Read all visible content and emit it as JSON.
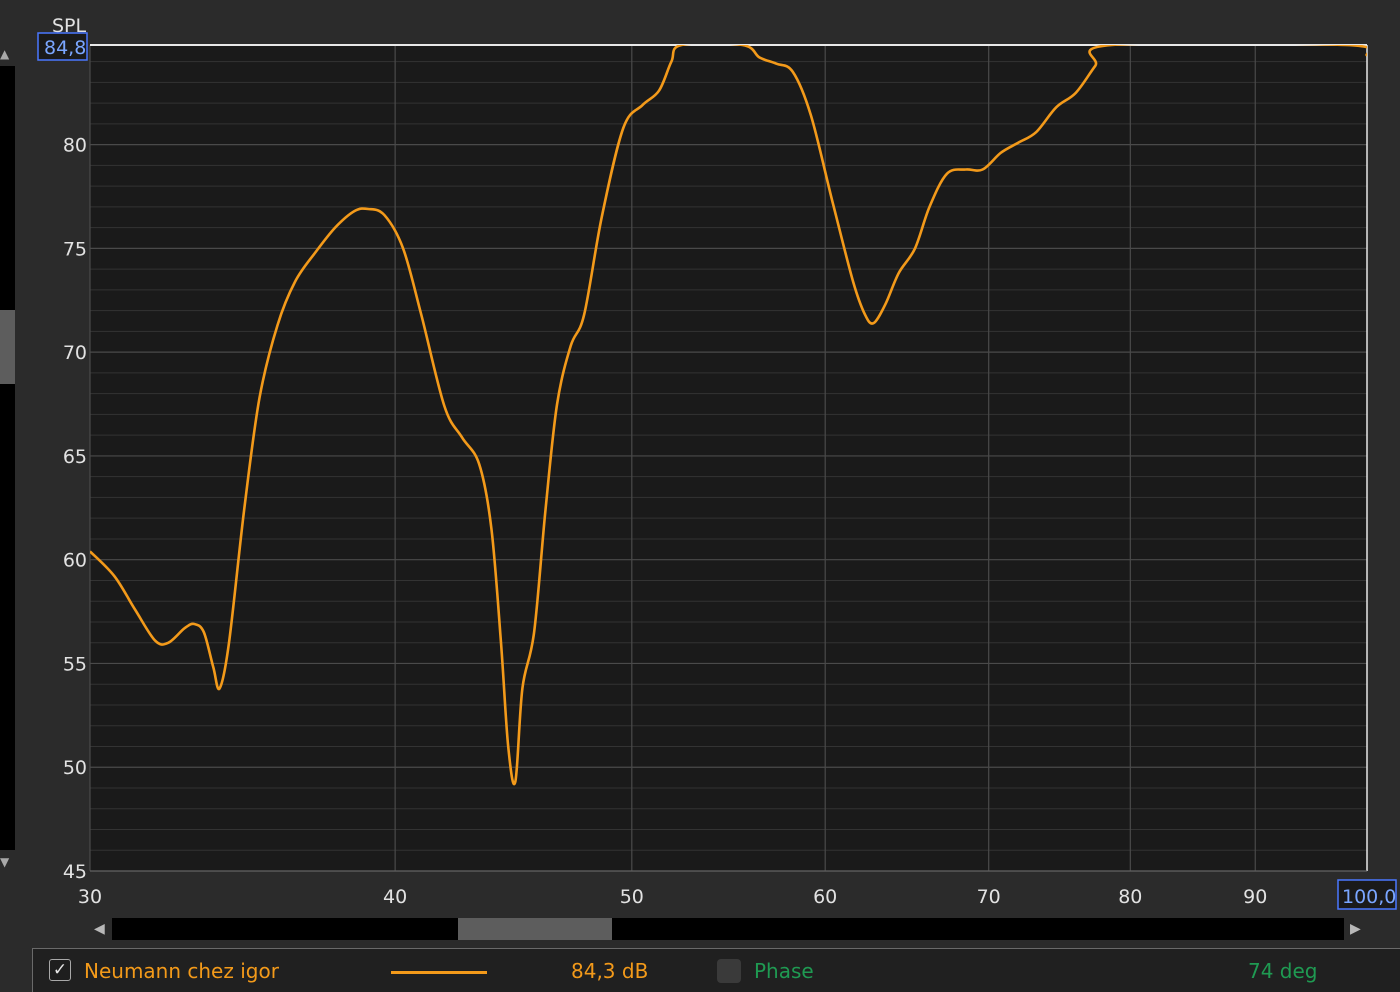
{
  "chart_data": {
    "type": "line",
    "ylabel": "SPL",
    "ylim": [
      45,
      84.8
    ],
    "xlim": [
      30,
      100
    ],
    "x_scale": "log",
    "grid": true,
    "ymax_readout": "84,8",
    "xmax_readout": "100,0",
    "y_ticks": [
      {
        "value": 45,
        "label": "45"
      },
      {
        "value": 50,
        "label": "50"
      },
      {
        "value": 55,
        "label": "55"
      },
      {
        "value": 60,
        "label": "60"
      },
      {
        "value": 65,
        "label": "65"
      },
      {
        "value": 70,
        "label": "70"
      },
      {
        "value": 75,
        "label": "75"
      },
      {
        "value": 80,
        "label": "80"
      }
    ],
    "x_ticks": [
      {
        "value": 30,
        "label": "30"
      },
      {
        "value": 40,
        "label": "40"
      },
      {
        "value": 50,
        "label": "50"
      },
      {
        "value": 60,
        "label": "60"
      },
      {
        "value": 70,
        "label": "70"
      },
      {
        "value": 80,
        "label": "80"
      },
      {
        "value": 90,
        "label": "90"
      }
    ],
    "series": [
      {
        "name": "Neumann chez igor",
        "color": "#f39a1a",
        "points": [
          [
            30.0,
            60.4
          ],
          [
            30.7,
            59.2
          ],
          [
            31.3,
            57.6
          ],
          [
            31.9,
            56.1
          ],
          [
            32.3,
            56.0
          ],
          [
            32.8,
            56.7
          ],
          [
            33.1,
            56.9
          ],
          [
            33.4,
            56.5
          ],
          [
            33.7,
            54.8
          ],
          [
            33.9,
            53.8
          ],
          [
            34.2,
            56.0
          ],
          [
            34.7,
            62.5
          ],
          [
            35.2,
            67.8
          ],
          [
            35.8,
            71.3
          ],
          [
            36.4,
            73.4
          ],
          [
            37.1,
            74.8
          ],
          [
            37.8,
            76.0
          ],
          [
            38.5,
            76.8
          ],
          [
            39.0,
            76.9
          ],
          [
            39.6,
            76.6
          ],
          [
            40.3,
            75.0
          ],
          [
            41.0,
            71.8
          ],
          [
            41.9,
            67.4
          ],
          [
            42.6,
            65.9
          ],
          [
            43.3,
            64.6
          ],
          [
            43.8,
            61.5
          ],
          [
            44.2,
            56.0
          ],
          [
            44.5,
            51.0
          ],
          [
            44.8,
            49.3
          ],
          [
            45.1,
            53.8
          ],
          [
            45.6,
            56.5
          ],
          [
            46.1,
            62.5
          ],
          [
            46.6,
            67.5
          ],
          [
            47.2,
            70.3
          ],
          [
            47.8,
            71.8
          ],
          [
            48.6,
            76.5
          ],
          [
            49.6,
            80.8
          ],
          [
            50.5,
            81.9
          ],
          [
            51.3,
            82.6
          ],
          [
            51.9,
            84.0
          ],
          [
            52.4,
            84.8
          ],
          [
            55.5,
            84.8
          ],
          [
            56.4,
            84.2
          ],
          [
            57.3,
            83.9
          ],
          [
            58.2,
            83.5
          ],
          [
            59.2,
            81.4
          ],
          [
            60.4,
            77.3
          ],
          [
            61.6,
            73.4
          ],
          [
            62.3,
            71.8
          ],
          [
            62.8,
            71.4
          ],
          [
            63.5,
            72.3
          ],
          [
            64.3,
            73.8
          ],
          [
            65.3,
            75.0
          ],
          [
            66.2,
            77.0
          ],
          [
            67.3,
            78.6
          ],
          [
            68.5,
            78.8
          ],
          [
            69.6,
            78.8
          ],
          [
            70.8,
            79.6
          ],
          [
            72.0,
            80.1
          ],
          [
            73.2,
            80.6
          ],
          [
            74.6,
            81.8
          ],
          [
            76.0,
            82.5
          ],
          [
            77.4,
            83.8
          ],
          [
            78.6,
            84.8
          ],
          [
            98.0,
            84.8
          ],
          [
            100.0,
            84.3
          ]
        ]
      }
    ]
  },
  "legend": {
    "series_name": "Neumann chez igor",
    "series_checked": true,
    "series_value": "84,3 dB",
    "phase_label": "Phase",
    "phase_checked": false,
    "phase_value": "74 deg"
  },
  "colors": {
    "trace": "#f39a1a",
    "phase": "#1f9a52",
    "grid_major": "#4a4a4a",
    "grid_minor": "#333333",
    "plot_bg": "#1a1a1a",
    "readout_box": "#4a78ff"
  }
}
